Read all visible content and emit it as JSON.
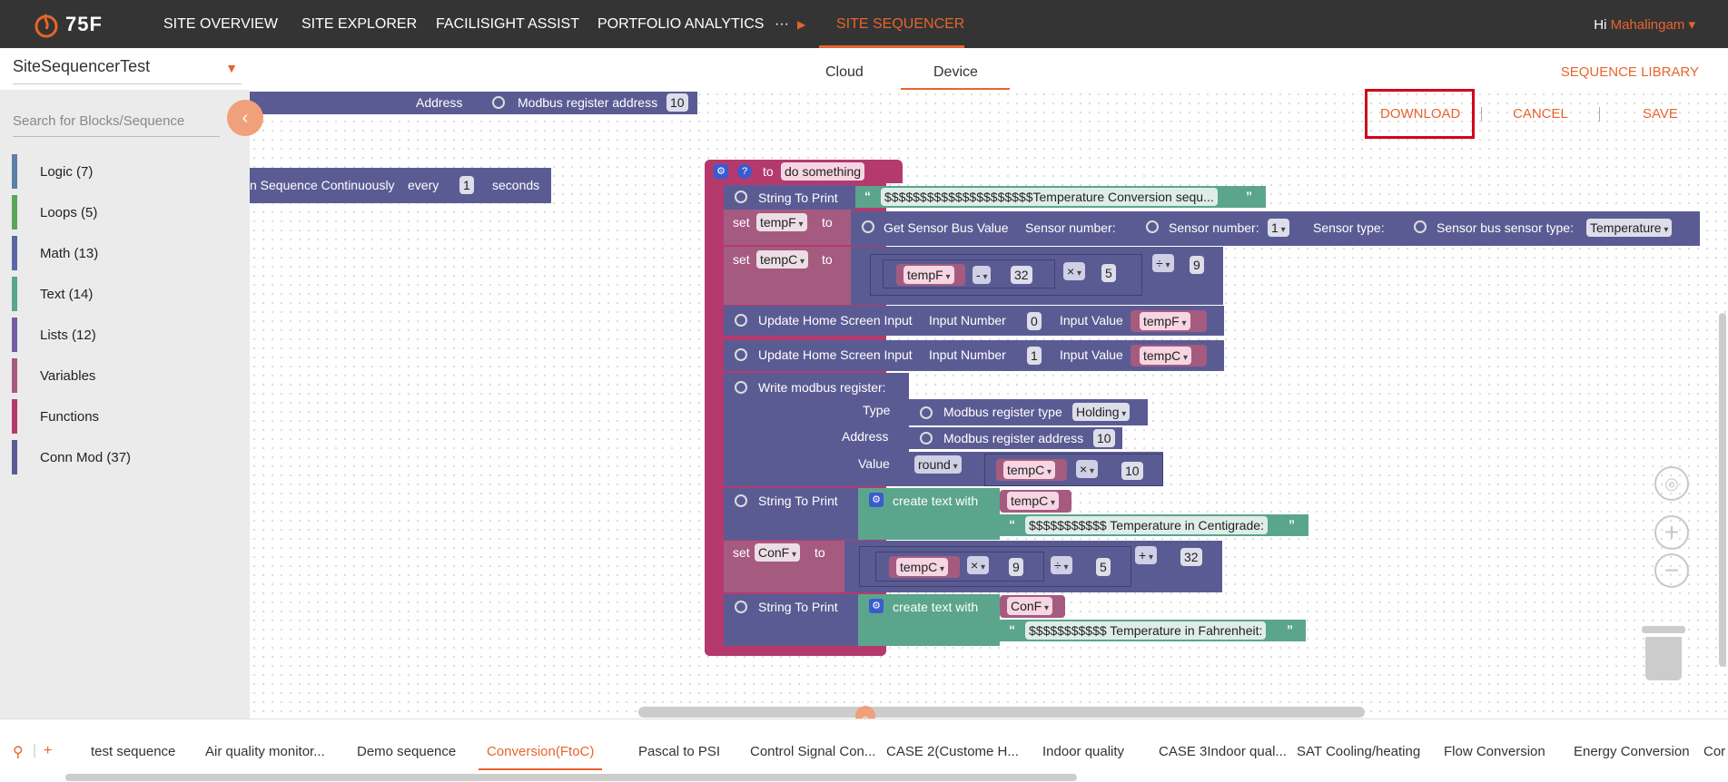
{
  "header": {
    "logo_text": "75F",
    "nav": [
      "SITE OVERVIEW",
      "SITE EXPLORER",
      "FACILISIGHT ASSIST",
      "PORTFOLIO ANALYTICS",
      "···",
      "SITE SEQUENCER"
    ],
    "greeting_hi": "Hi",
    "user_name": "Mahalingam ▾"
  },
  "subbar": {
    "site_name": "SiteSequencerTest",
    "tabs": [
      "Cloud",
      "Device"
    ],
    "sequence_library": "SEQUENCE LIBRARY"
  },
  "actions": {
    "download": "DOWNLOAD",
    "cancel": "CANCEL",
    "save": "SAVE"
  },
  "sidebar": {
    "search_placeholder": "Search for Blocks/Sequence",
    "categories": [
      {
        "label": "Logic (7)",
        "color": "#5b80a5"
      },
      {
        "label": "Loops (5)",
        "color": "#5ba55b"
      },
      {
        "label": "Math (13)",
        "color": "#5b67a5"
      },
      {
        "label": "Text (14)",
        "color": "#5ba58c"
      },
      {
        "label": "Lists (12)",
        "color": "#745ba5"
      },
      {
        "label": "Variables",
        "color": "#a55b80"
      },
      {
        "label": "Functions",
        "color": "#b43a6e"
      },
      {
        "label": "Conn Mod (37)",
        "color": "#5b5b94"
      }
    ]
  },
  "blocks": {
    "top_addr_label": "Address",
    "top_addr_block": "Modbus register address",
    "top_addr_value": "10",
    "run_seq": "n Sequence Continuously",
    "run_every": "every",
    "run_value": "1",
    "run_seconds": "seconds",
    "func_to": "to",
    "func_name": "do something",
    "print1_label": "String To Print",
    "print1_text": "$$$$$$$$$$$$$$$$$$$$$Temperature Conversion sequ...",
    "set": "set",
    "to": "to",
    "tempF": "tempF",
    "tempC": "tempC",
    "conF": "ConF",
    "get_sensor": "Get Sensor Bus Value",
    "sensor_number_label": "Sensor number:",
    "sensor_number_block": "Sensor number:",
    "sensor_number_value": "1",
    "sensor_type_label": "Sensor type:",
    "sensor_type_block": "Sensor bus sensor type:",
    "sensor_type_value": "Temperature",
    "op_minus": "-",
    "op_times": "×",
    "op_div": "÷",
    "op_plus": "+",
    "num_32": "32",
    "num_5": "5",
    "num_9": "9",
    "num_10": "10",
    "num_0": "0",
    "num_1": "1",
    "update_home": "Update Home Screen Input",
    "input_number": "Input Number",
    "input_value": "Input Value",
    "write_modbus": "Write modbus register:",
    "type": "Type",
    "address": "Address",
    "value": "Value",
    "modbus_type_block": "Modbus register type",
    "modbus_type_value": "Holding",
    "modbus_addr_block": "Modbus register address",
    "round": "round",
    "create_text": "create text with",
    "centigrade_text": "$$$$$$$$$$$ Temperature in Centigrade:",
    "fahrenheit_text": "$$$$$$$$$$$ Temperature in Fahrenheit:"
  },
  "bottom_tabs": [
    "test sequence",
    "Air quality monitor...",
    "Demo sequence",
    "Conversion(FtoC)",
    "Pascal to PSI",
    "Control Signal Con...",
    "CASE 2(Custome H...",
    "Indoor quality",
    "CASE 3Indoor qual...",
    "SAT Cooling/heating",
    "Flow Conversion",
    "Energy Conversion",
    "Cor"
  ]
}
